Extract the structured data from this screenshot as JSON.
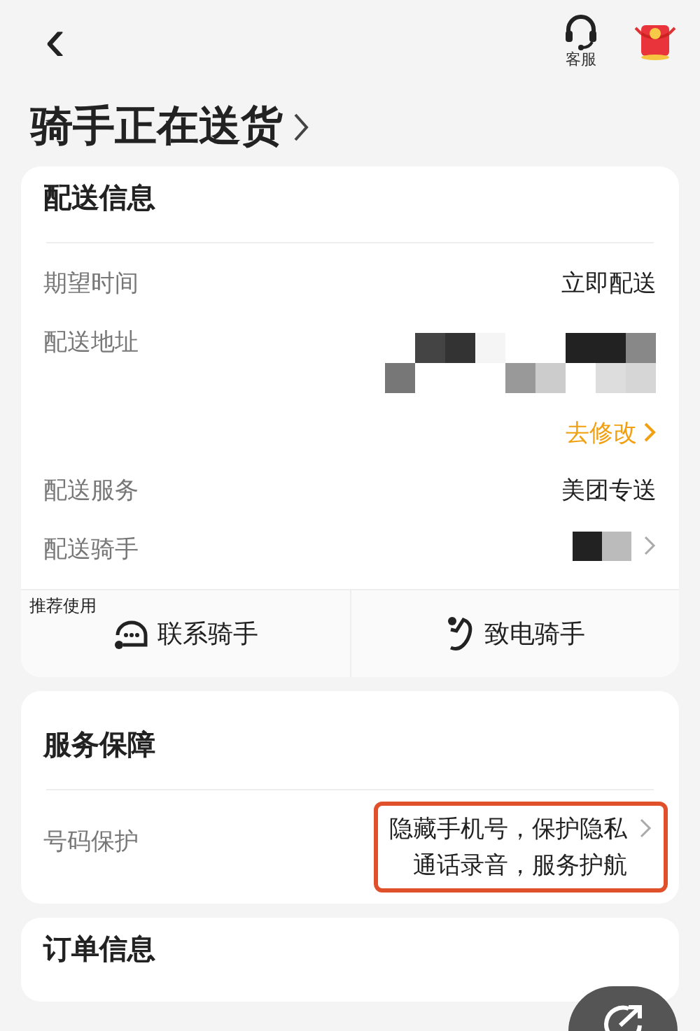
{
  "header": {
    "back": "‹",
    "service_label": "客服"
  },
  "status_title": "骑手正在送货",
  "delivery_card": {
    "title": "配送信息",
    "rows": [
      {
        "kind": "text",
        "label": "期望时间",
        "value": "立即配送"
      },
      {
        "kind": "mosaic",
        "label": "配送地址"
      },
      {
        "kind": "link",
        "value": "去修改"
      },
      {
        "kind": "text",
        "label": "配送服务",
        "value": "美团专送"
      },
      {
        "kind": "rider",
        "label": "配送骑手"
      }
    ],
    "badge": "推荐使用",
    "actions": [
      {
        "kind": "chat",
        "label": "联系骑手"
      },
      {
        "kind": "phone",
        "label": "致电骑手"
      }
    ]
  },
  "guarantee_card": {
    "title": "服务保障",
    "rows": [
      {
        "label": "号码保护",
        "lines": [
          "隐藏手机号，保护隐私",
          "通话录音，服务护航"
        ],
        "highlighted": true
      }
    ]
  },
  "order_card": {
    "title": "订单信息"
  }
}
